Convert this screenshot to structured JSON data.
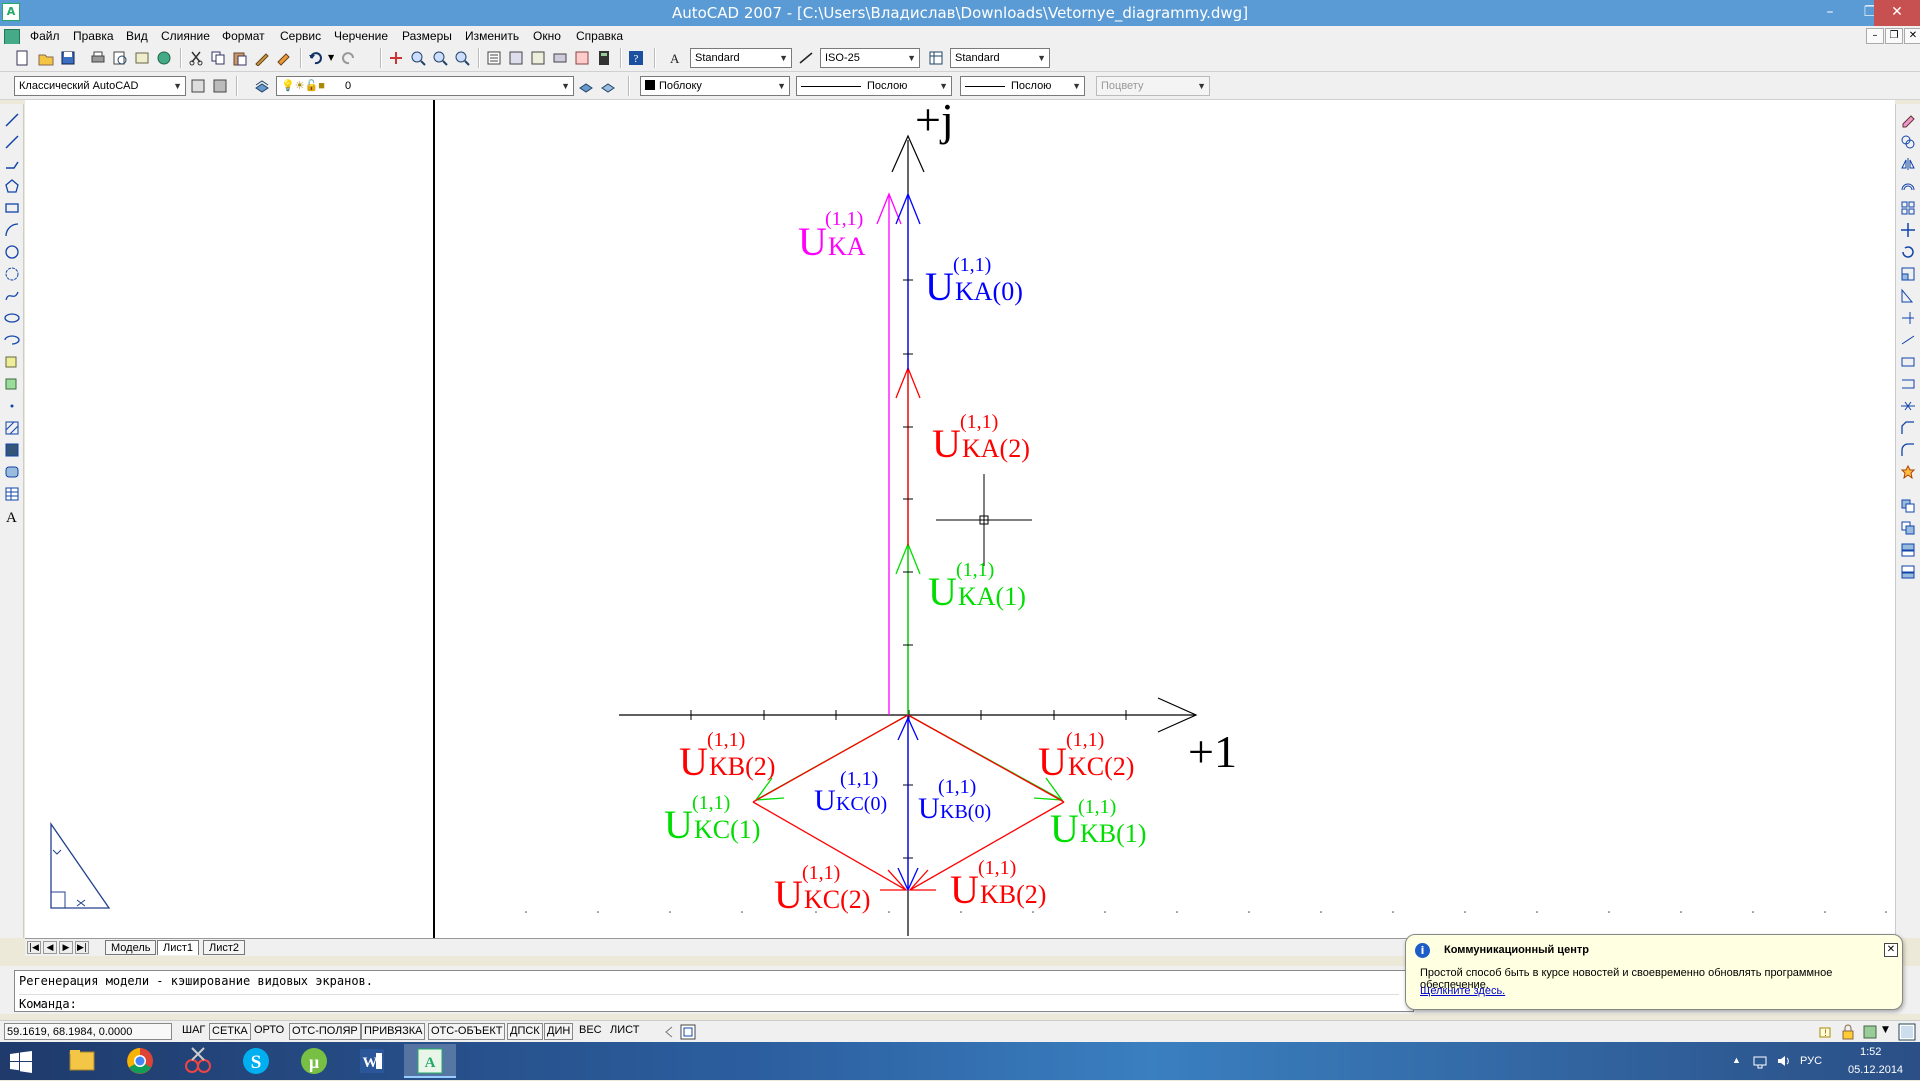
{
  "window": {
    "title": "AutoCAD 2007 - [C:\\Users\\Владислав\\Downloads\\Vetornye_diagrammy.dwg]",
    "app_icon": "A"
  },
  "menu": {
    "items": [
      "Файл",
      "Правка",
      "Вид",
      "Слияние",
      "Формат",
      "Сервис",
      "Черчение",
      "Размеры",
      "Изменить",
      "Окно",
      "Справка"
    ]
  },
  "toolbar1": {
    "text_style": "Standard",
    "dim_style": "ISO-25",
    "table_style": "Standard"
  },
  "toolbar2": {
    "workspace": "Классический AutoCAD",
    "layer": "0",
    "color": "Поблоку",
    "linetype": "Послою",
    "lineweight": "Послою",
    "plotstyle": "Поцвету"
  },
  "layout_tabs": [
    "Модель",
    "Лист1",
    "Лист2"
  ],
  "active_tab": "Лист1",
  "command": {
    "history": "Регенерация модели - кэширование видовых экранов.",
    "prompt": "Команда:"
  },
  "status": {
    "coordinates": "59.1619, 68.1984, 0.0000",
    "buttons": [
      "ШАГ",
      "СЕТКА",
      "ОРТО",
      "ОТС-ПОЛЯР",
      "ПРИВЯЗКА",
      "ОТС-ОБЪЕКТ",
      "ДПСК",
      "ДИН",
      "ВЕС",
      "ЛИСТ"
    ]
  },
  "balloon": {
    "title": "Коммуникационный центр",
    "body": "Простой способ быть в курсе новостей и своевременно обновлять программное обеспечение.",
    "link": "Щелкните здесь."
  },
  "taskbar": {
    "lang": "РУС",
    "time": "1:52",
    "date": "05.12.2014",
    "apps": [
      "explorer-icon",
      "chrome-icon",
      "snipping-icon",
      "skype-icon",
      "utorrent-icon",
      "word-icon",
      "autocad-icon"
    ]
  },
  "diagram": {
    "axis_imag_label": "+j",
    "axis_real_label": "+1",
    "colors": {
      "magenta": "#ff00ff",
      "blue": "#0000ff",
      "red": "#ff0000",
      "green": "#00dd00"
    },
    "labels": [
      {
        "base": "U",
        "sub": "KA",
        "sup": "(1,1)",
        "color": "magenta"
      },
      {
        "base": "U",
        "sub": "KA(0)",
        "sup": "(1,1)",
        "color": "blue"
      },
      {
        "base": "U",
        "sub": "KA(2)",
        "sup": "(1,1)",
        "color": "red"
      },
      {
        "base": "U",
        "sub": "KA(1)",
        "sup": "(1,1)",
        "color": "green"
      },
      {
        "base": "U",
        "sub": "KB(2)",
        "sup": "(1,1)",
        "color": "red"
      },
      {
        "base": "U",
        "sub": "KC(0)",
        "sup": "(1,1)",
        "color": "blue"
      },
      {
        "base": "U",
        "sub": "KB(0)",
        "sup": "(1,1)",
        "color": "blue"
      },
      {
        "base": "U",
        "sub": "KC(2)",
        "sup": "(1,1)",
        "color": "red"
      },
      {
        "base": "U",
        "sub": "KC(1)",
        "sup": "(1,1)",
        "color": "green"
      },
      {
        "base": "U",
        "sub": "KB(1)",
        "sup": "(1,1)",
        "color": "green"
      },
      {
        "base": "U",
        "sub": "KC(2)",
        "sup": "(1,1)",
        "color": "red"
      },
      {
        "base": "U",
        "sub": "KB(2)",
        "sup": "(1,1)",
        "color": "red"
      }
    ]
  }
}
